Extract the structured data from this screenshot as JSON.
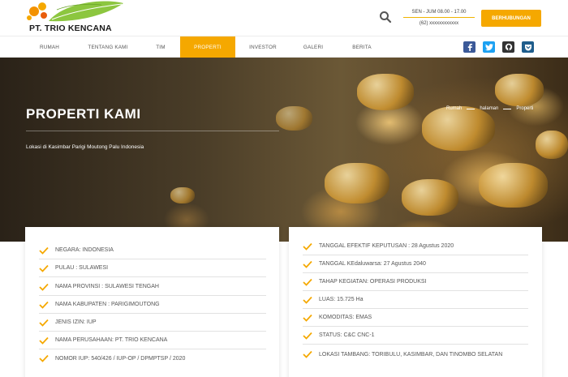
{
  "brand": {
    "name": "PT. TRIO KENCANA"
  },
  "header": {
    "hours_line1": "SEN - JUM 08.00 - 17.00",
    "hours_line2": "(62) xxxxxxxxxxxx",
    "contact_label": "BERHUBUNGAN",
    "accent": "#f5a800"
  },
  "nav": {
    "items": [
      {
        "label": "RUMAH"
      },
      {
        "label": "TENTANG KAMI"
      },
      {
        "label": "TIM"
      },
      {
        "label": "PROPERTI"
      },
      {
        "label": "INVESTOR"
      },
      {
        "label": "GALERI"
      },
      {
        "label": "BERITA"
      }
    ],
    "active": "PROPERTI",
    "social": [
      {
        "icon": "facebook-icon",
        "color": "#3b5998"
      },
      {
        "icon": "twitter-icon",
        "color": "#1da1f2"
      },
      {
        "icon": "github-icon",
        "color": "#333333"
      },
      {
        "icon": "pocket-icon",
        "color": "#1f5d8c"
      }
    ]
  },
  "hero": {
    "title": "PROPERTI KAMI",
    "subtitle": "Lokasi di Kasimbar Parigi Moutong Palu Indonesia",
    "breadcrumb": [
      "Rumah",
      "halaman",
      "Properti"
    ]
  },
  "left_list": [
    "NEGARA: INDONESIA",
    "PULAU : SULAWESI",
    "NAMA PROVINSI : SULAWESI TENGAH",
    "NAMA KABUPATEN : PARIGIMOUTONG",
    "JENIS IZIN: IUP",
    "NAMA PERUSAHAAN: PT. TRIO KENCANA",
    "NOMOR IUP: 540/426 / IUP-OP / DPMPTSP / 2020"
  ],
  "right_list": [
    "TANGGAL EFEKTIF KEPUTUSAN : 28 Agustus 2020",
    "TANGGAL KEdaluwarsa: 27 Agustus 2040",
    "TAHAP KEGIATAN: OPERASI PRODUKSI",
    "LUAS: 15.725 Ha",
    "KOMODITAS: EMAS",
    "STATUS: C&C CNC-1",
    "LOKASI TAMBANG: TORIBULU, KASIMBAR, DAN TINOMBO SELATAN"
  ]
}
